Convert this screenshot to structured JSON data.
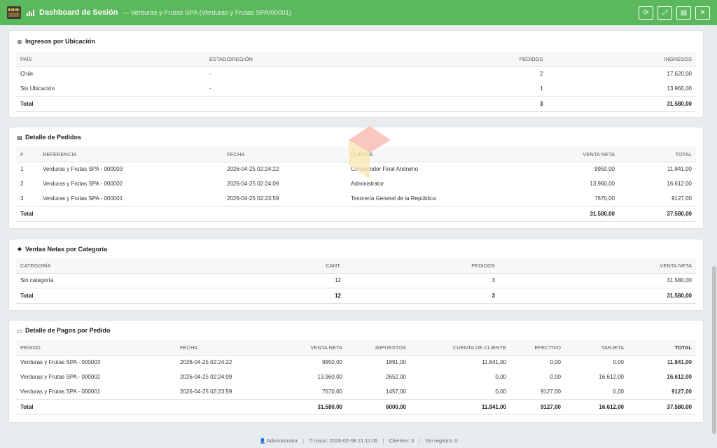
{
  "window": {
    "title": "Dashboard de Sesión",
    "subtitle": "— Verduras y Frutas SPA (Verduras y Frutas SPA/00001)",
    "buttons": {
      "refresh": "⟳",
      "expand": "⤢",
      "pdf": "▤",
      "close": "✕"
    }
  },
  "ingresos": {
    "title": "Ingresos por Ubicación",
    "headers": [
      "PAÍS",
      "ESTADO/REGIÓN",
      "PEDIDOS",
      "INGRESOS"
    ],
    "rows": [
      [
        "Chile",
        "-",
        "2",
        "17.620,00"
      ],
      [
        "Sin Ubicación",
        "-",
        "1",
        "13.960,00"
      ]
    ],
    "total": [
      "Total",
      "",
      "3",
      "31.580,00"
    ]
  },
  "pedidos": {
    "title": "Detalle de Pedidos",
    "headers": [
      "#",
      "REFERENCIA",
      "FECHA",
      "CLIENTE",
      "VENTA NETA",
      "TOTAL"
    ],
    "rows": [
      [
        "1",
        "Verduras y Frutas SPA - 000003",
        "2026-04-25 02:24:22",
        "Consumidor Final Anónimo",
        "9950,00",
        "11.841,00"
      ],
      [
        "2",
        "Verduras y Frutas SPA - 000002",
        "2026-04-25 02:24:09",
        "Administrator",
        "13.960,00",
        "16.612,00"
      ],
      [
        "3",
        "Verduras y Frutas SPA - 000001",
        "2026-04-25 02:23:59",
        "Tesorería General de la República",
        "7670,00",
        "9127,00"
      ]
    ],
    "total": [
      "Total",
      "",
      "",
      "",
      "31.580,00",
      "37.580,00"
    ]
  },
  "categorias": {
    "title": "Ventas Netas por Categoría",
    "headers": [
      "CATEGORÍA",
      "CANT.",
      "PEDIDOS",
      "VENTA NETA"
    ],
    "rows": [
      [
        "Sin categoría",
        "12",
        "3",
        "31.580,00"
      ]
    ],
    "total": [
      "Total",
      "12",
      "3",
      "31.580,00"
    ]
  },
  "pagos": {
    "title": "Detalle de Pagos por Pedido",
    "headers": [
      "PEDIDO",
      "FECHA",
      "VENTA NETA",
      "IMPUESTOS",
      "CUENTA DE CLIENTE",
      "EFECTIVO",
      "TARJETA",
      "TOTAL"
    ],
    "rows": [
      [
        "Verduras y Frutas SPA - 000003",
        "2026-04-25 02:24:22",
        "9950,00",
        "1891,00",
        "11.841,00",
        "0,00",
        "0,00",
        "11.841,00"
      ],
      [
        "Verduras y Frutas SPA - 000002",
        "2026-04-25 02:24:09",
        "13.960,00",
        "2652,00",
        "0,00",
        "0,00",
        "16.612,00",
        "16.612,00"
      ],
      [
        "Verduras y Frutas SPA - 000001",
        "2026-04-25 02:23:59",
        "7670,00",
        "1457,00",
        "0,00",
        "9127,00",
        "0,00",
        "9127,00"
      ]
    ],
    "total": [
      "Total",
      "",
      "31.580,00",
      "6000,00",
      "11.841,00",
      "9127,00",
      "16.612,00",
      "37.580,00"
    ]
  },
  "footer": {
    "user": "Administrator",
    "inicio": "Inicio: 2026-02-08 21:11:05",
    "clientes": "Clientes: 3",
    "registro": "Sin registro: 0"
  },
  "icons": {
    "globe": "globe-icon",
    "list": "list-icon",
    "tags": "tags-icon",
    "card": "credit-card-icon"
  },
  "colors": {
    "titlebar": "#5cb85c"
  }
}
